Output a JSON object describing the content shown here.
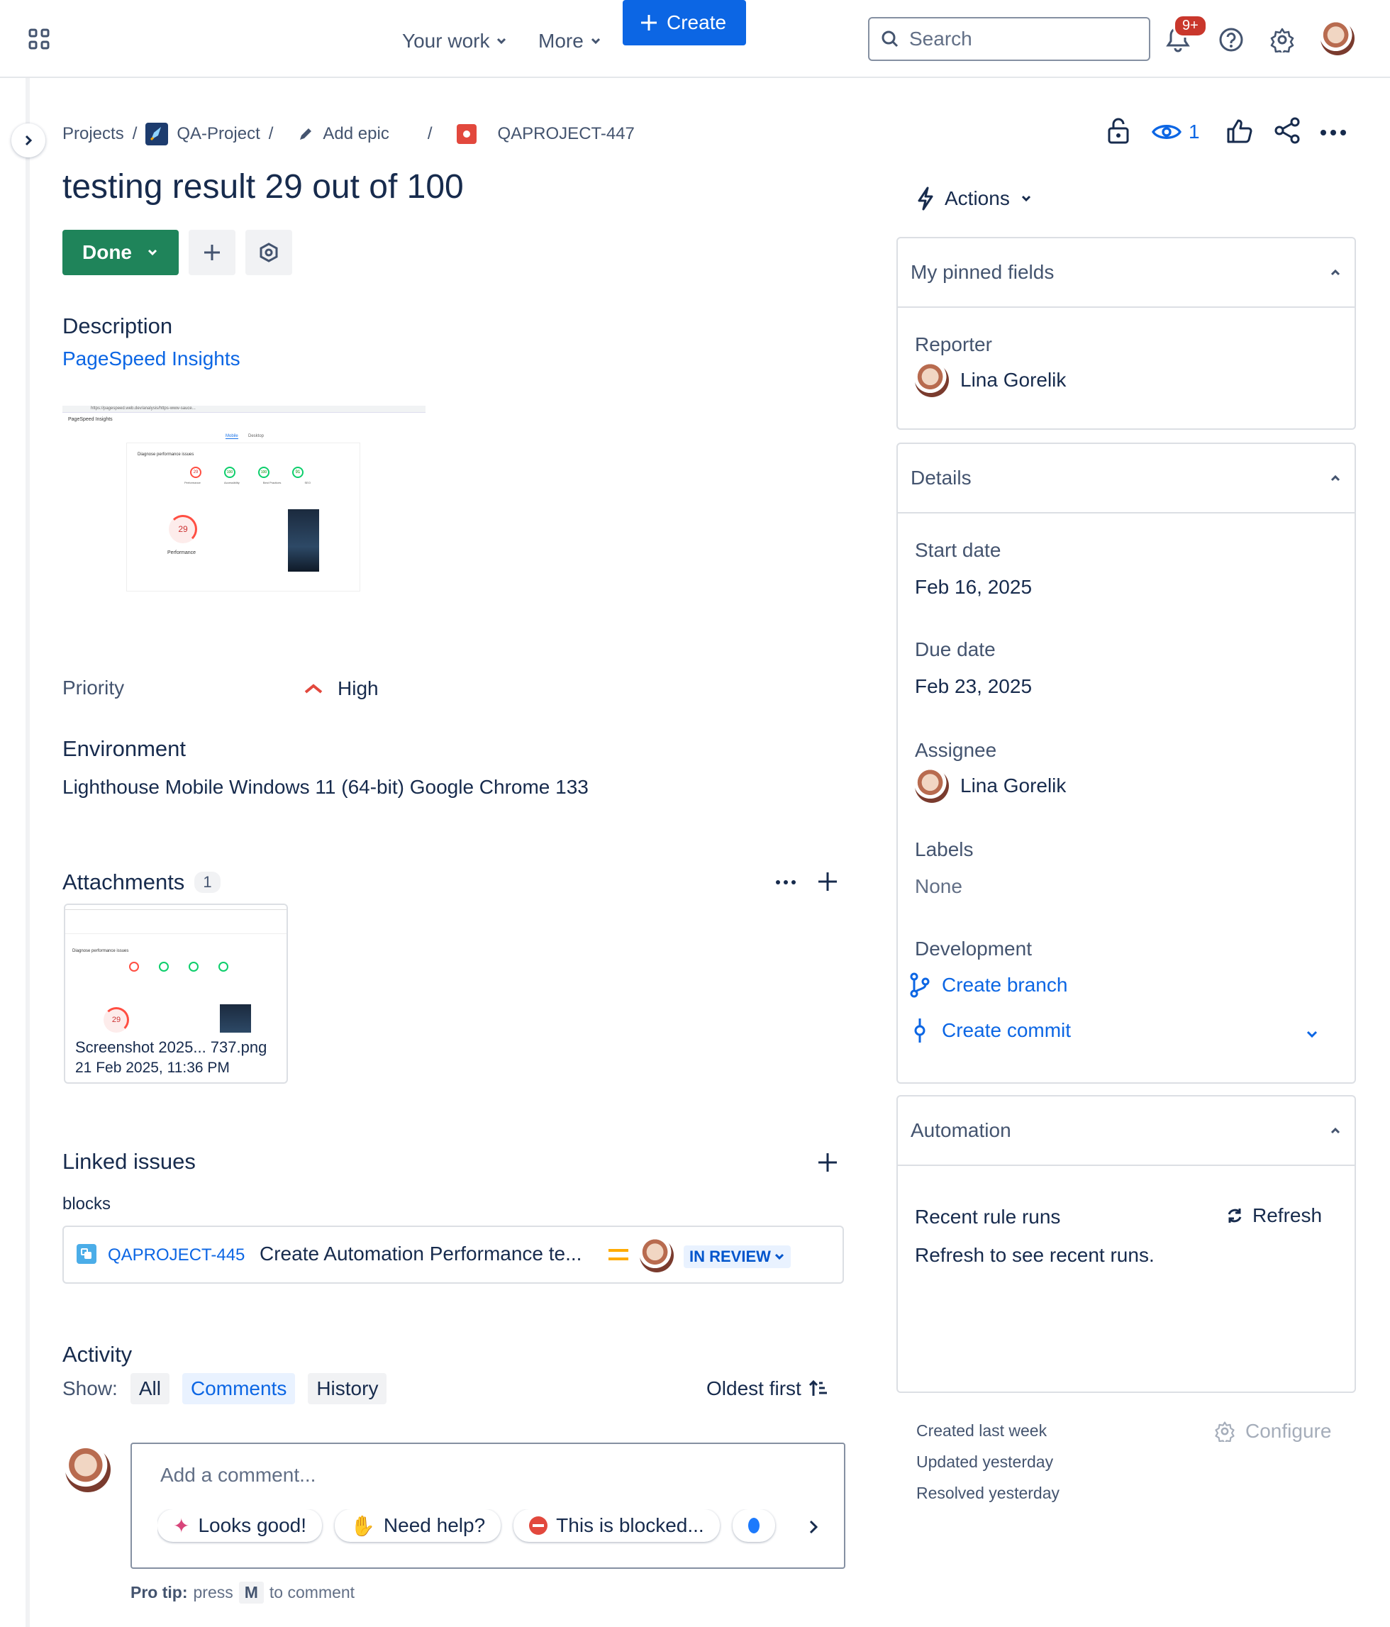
{
  "topbar": {
    "your_work": "Your work",
    "more": "More",
    "create": "Create",
    "search_placeholder": "Search",
    "notifications_badge": "9+"
  },
  "breadcrumb": {
    "projects": "Projects",
    "project": "QA-Project",
    "add_epic": "Add epic",
    "issue_key": "QAPROJECT-447",
    "watchers": "1"
  },
  "issue": {
    "title": "testing result 29 out of 100",
    "status": "Done"
  },
  "description": {
    "heading": "Description",
    "link": "PageSpeed Insights"
  },
  "thumbnail": {
    "url_bar": "https://pagespeed.web.dev/analysis/https-www-sauce...",
    "brand": "PageSpeed Insights",
    "tab_mobile": "Mobile",
    "tab_desktop": "Desktop",
    "section": "Diagnose performance issues",
    "scores": [
      "29",
      "100",
      "100",
      "91"
    ],
    "score_labels": [
      "Performance",
      "Accessibility",
      "Best Practices",
      "SEO"
    ],
    "big_score": "29",
    "big_label": "Performance"
  },
  "fields": {
    "priority_label": "Priority",
    "priority_value": "High",
    "environment_heading": "Environment",
    "environment_value": "Lighthouse Mobile Windows 11 (64-bit) Google Chrome 133"
  },
  "attachments": {
    "heading": "Attachments",
    "count": "1",
    "file_name": "Screenshot 2025... 737.png",
    "file_date": "21 Feb 2025, 11:36 PM"
  },
  "linked": {
    "heading": "Linked issues",
    "relation": "blocks",
    "key": "QAPROJECT-445",
    "summary": "Create Automation Performance te...",
    "status": "IN REVIEW"
  },
  "activity": {
    "heading": "Activity",
    "show": "Show:",
    "tabs": [
      "All",
      "Comments",
      "History"
    ],
    "sort": "Oldest first",
    "placeholder": "Add a comment...",
    "chips": [
      "Looks good!",
      "Need help?",
      "This is blocked..."
    ],
    "protip_bold": "Pro tip:",
    "protip_press": "press",
    "protip_key": "M",
    "protip_rest": "to comment"
  },
  "sidebar": {
    "actions": "Actions",
    "pinned_heading": "My pinned fields",
    "reporter_label": "Reporter",
    "reporter": "Lina Gorelik",
    "details_heading": "Details",
    "start_label": "Start date",
    "start_value": "Feb 16, 2025",
    "due_label": "Due date",
    "due_value": "Feb 23, 2025",
    "assignee_label": "Assignee",
    "assignee": "Lina Gorelik",
    "labels_label": "Labels",
    "labels_value": "None",
    "development_label": "Development",
    "create_branch": "Create branch",
    "create_commit": "Create commit",
    "automation_heading": "Automation",
    "recent_runs": "Recent rule runs",
    "refresh": "Refresh",
    "refresh_hint": "Refresh to see recent runs.",
    "created": "Created last week",
    "updated": "Updated yesterday",
    "resolved": "Resolved yesterday",
    "configure": "Configure"
  },
  "colors": {
    "primary": "#0c66e4",
    "done": "#1f845a",
    "priority_high": "#e2483d",
    "badge": "#c9372c"
  }
}
